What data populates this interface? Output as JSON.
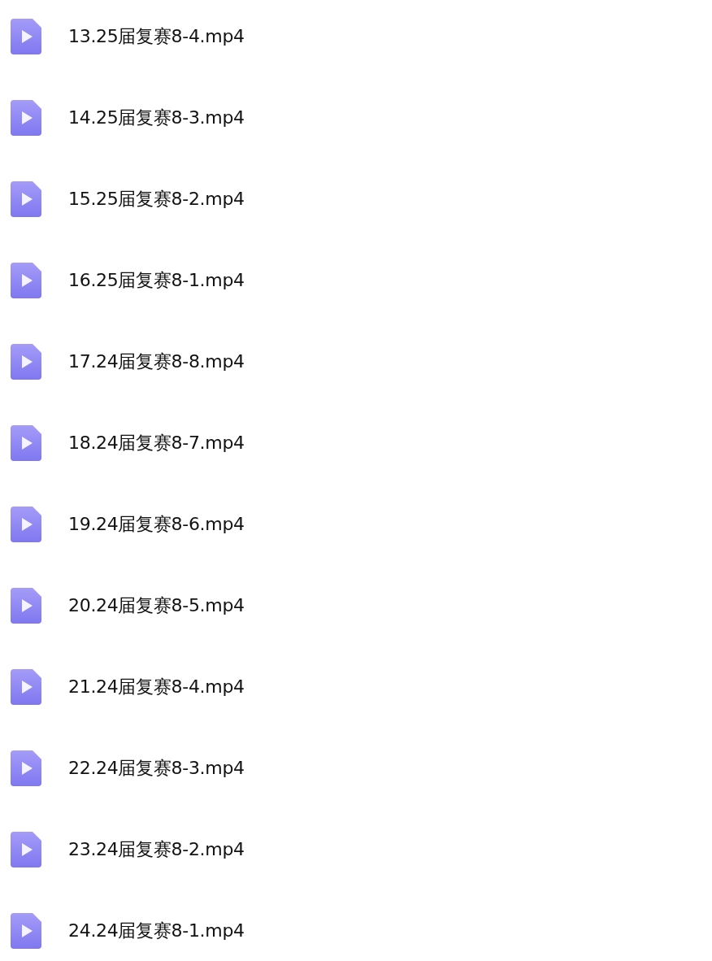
{
  "files": [
    {
      "name": "13.25届复赛8-4.mp4",
      "kind": "video"
    },
    {
      "name": "14.25届复赛8-3.mp4",
      "kind": "video"
    },
    {
      "name": "15.25届复赛8-2.mp4",
      "kind": "video"
    },
    {
      "name": "16.25届复赛8-1.mp4",
      "kind": "video"
    },
    {
      "name": "17.24届复赛8-8.mp4",
      "kind": "video"
    },
    {
      "name": "18.24届复赛8-7.mp4",
      "kind": "video"
    },
    {
      "name": "19.24届复赛8-6.mp4",
      "kind": "video"
    },
    {
      "name": "20.24届复赛8-5.mp4",
      "kind": "video"
    },
    {
      "name": "21.24届复赛8-4.mp4",
      "kind": "video"
    },
    {
      "name": "22.24届复赛8-3.mp4",
      "kind": "video"
    },
    {
      "name": "23.24届复赛8-2.mp4",
      "kind": "video"
    },
    {
      "name": "24.24届复赛8-1.mp4",
      "kind": "video"
    }
  ]
}
